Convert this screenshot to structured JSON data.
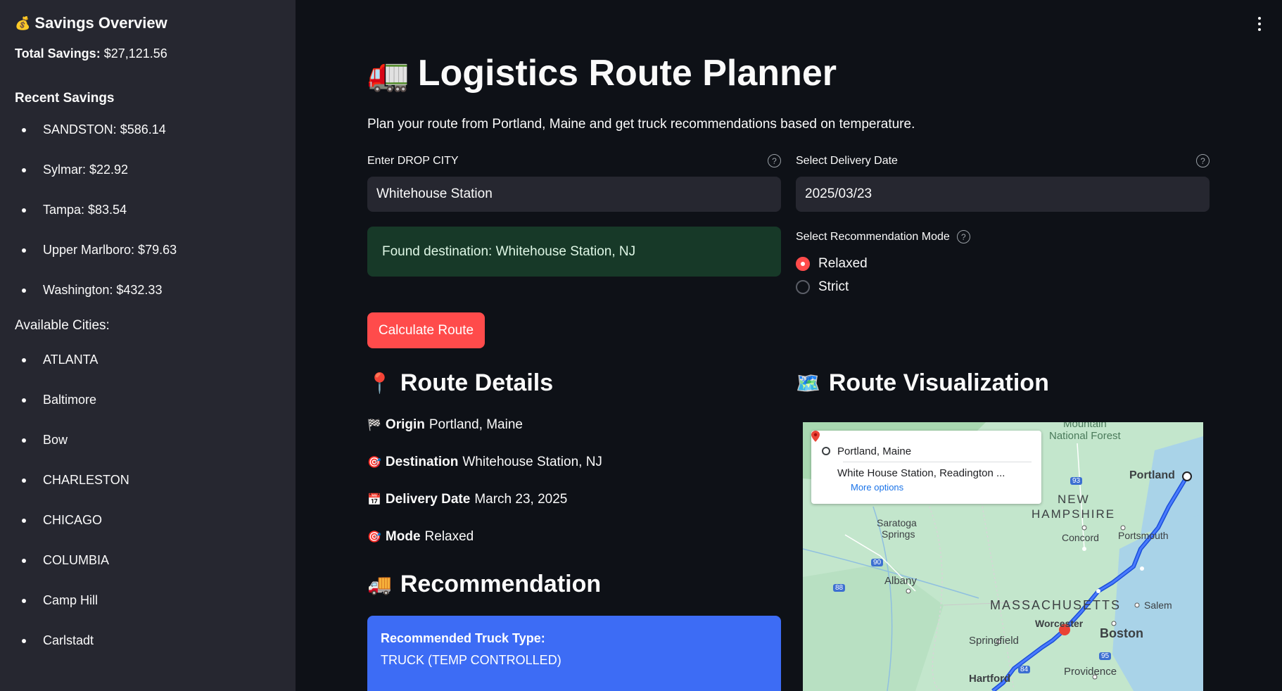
{
  "sidebar": {
    "title": "Savings Overview",
    "title_icon": "moneybag-icon",
    "total_label": "Total Savings:",
    "total_value": "$27,121.56",
    "recent_heading": "Recent Savings",
    "recent": [
      "SANDSTON: $586.14",
      "Sylmar: $22.92",
      "Tampa: $83.54",
      "Upper Marlboro: $79.63",
      "Washington: $432.33"
    ],
    "cities_heading": "Available Cities:",
    "cities": [
      "ATLANTA",
      "Baltimore",
      "Bow",
      "CHARLESTON",
      "CHICAGO",
      "COLUMBIA",
      "Camp Hill",
      "Carlstadt"
    ]
  },
  "header": {
    "title": "Logistics Route Planner",
    "title_icon": "truck-icon",
    "subtitle": "Plan your route from Portland, Maine and get truck recommendations based on temperature."
  },
  "form": {
    "drop_city_label": "Enter DROP CITY",
    "drop_city_value": "Whitehouse Station",
    "date_label": "Select Delivery Date",
    "date_value": "2025/03/23",
    "found_message": "Found destination: Whitehouse Station, NJ",
    "mode_label": "Select Recommendation Mode",
    "mode_options": [
      "Relaxed",
      "Strict"
    ],
    "mode_selected": "Relaxed",
    "calculate_label": "Calculate Route"
  },
  "route_details": {
    "heading": "Route Details",
    "origin_label": "Origin",
    "origin_value": "Portland, Maine",
    "destination_label": "Destination",
    "destination_value": "Whitehouse Station, NJ",
    "date_label": "Delivery Date",
    "date_value": "March 23, 2025",
    "mode_label": "Mode",
    "mode_value": "Relaxed"
  },
  "recommendation": {
    "heading": "Recommendation",
    "title": "Recommended Truck Type:",
    "value": "TRUCK (TEMP CONTROLLED)"
  },
  "visualization": {
    "heading": "Route Visualization",
    "map_card": {
      "origin": "Portland, Maine",
      "destination": "White House Station, Readington ...",
      "more_options": "More options"
    },
    "labels": {
      "forest": "Mountain\nNational Forest",
      "portland": "Portland",
      "new": "NEW",
      "hampshire": "HAMPSHIRE",
      "saratoga": "Saratoga",
      "springs": "Springs",
      "concord": "Concord",
      "portsmouth": "Portsmouth",
      "albany": "Albany",
      "massachusetts": "MASSACHUSETTS",
      "salem": "Salem",
      "worcester": "Worcester",
      "boston": "Boston",
      "springfield": "Springfield",
      "hartford": "Hartford",
      "providence": "Providence",
      "hw93": "93",
      "hw90": "90",
      "hw88": "88",
      "hw95": "95",
      "hw84": "84"
    }
  },
  "colors": {
    "background": "#0e1117",
    "sidebar": "#262730",
    "accent": "#ff4b4b",
    "success_bg": "#173928",
    "info_blue": "#3d6cf5"
  }
}
